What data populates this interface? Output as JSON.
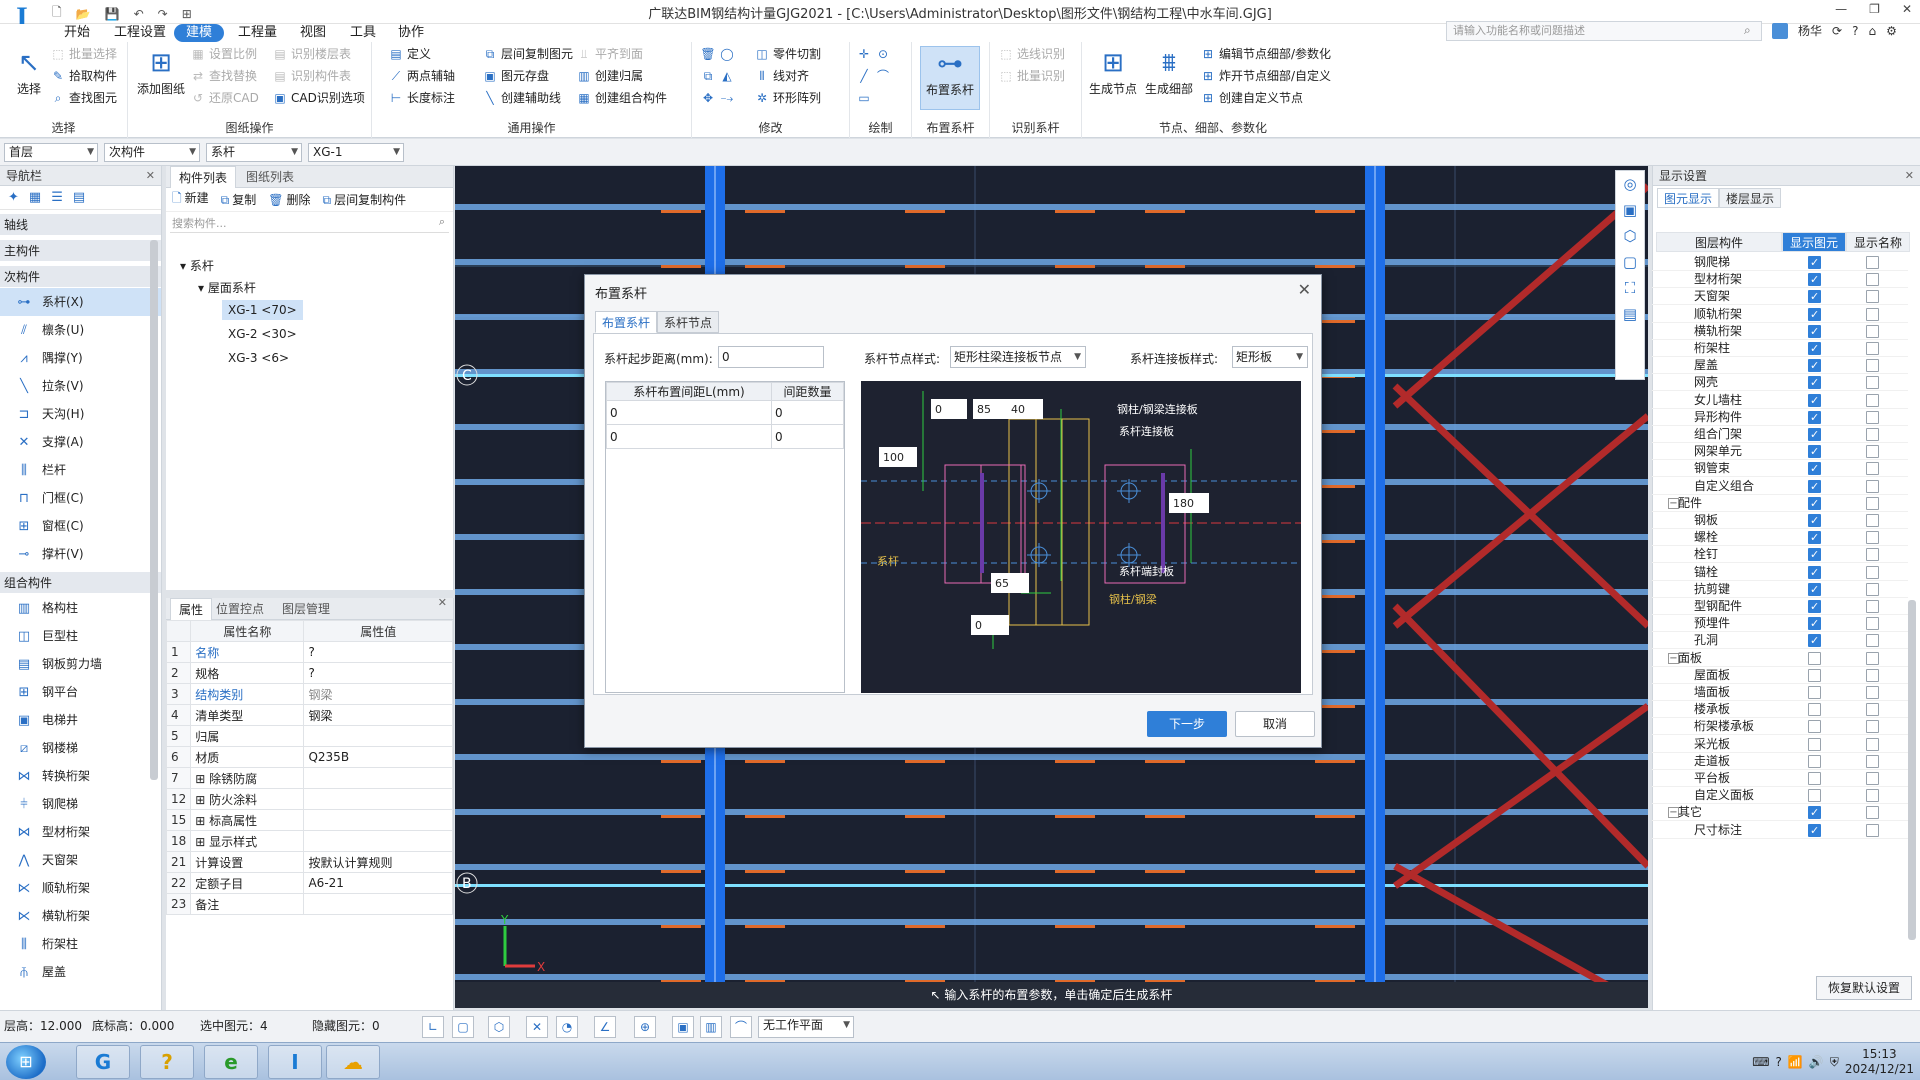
{
  "app": {
    "title": "广联达BIM钢结构计量GJG2021 - [C:\\Users\\Administrator\\Desktop\\图形文件\\钢结构工程\\中水车间.GJG]",
    "logo": "I"
  },
  "menu": {
    "items": [
      "开始",
      "工程设置",
      "建模",
      "工程量",
      "视图",
      "工具",
      "协作"
    ],
    "active": "建模"
  },
  "search": {
    "placeholder": "请输入功能名称或问题描述"
  },
  "user": {
    "name": "杨华"
  },
  "ribbon": {
    "select": {
      "big": "选择",
      "s1": "批量选择",
      "s2": "拾取构件",
      "s3": "查找图元",
      "title": "选择"
    },
    "drawing": {
      "big": "添加图纸",
      "s1": "设置比例",
      "s2": "查找替换",
      "s3": "还原CAD",
      "s4": "识别楼层表",
      "s5": "识别构件表",
      "s6": "CAD识别选项",
      "title": "图纸操作"
    },
    "general": {
      "s1": "定义",
      "s2": "两点辅轴",
      "s3": "长度标注",
      "s4": "层间复制图元",
      "s5": "图元存盘",
      "s6": "创建辅助线",
      "s7": "平齐到面",
      "s8": "创建归属",
      "s9": "创建组合构件",
      "title": "通用操作"
    },
    "modify": {
      "s1": "零件切割",
      "s2": "线对齐",
      "s3": "环形阵列",
      "title": "修改"
    },
    "draw": {
      "title": "绘制"
    },
    "arrange": {
      "big": "布置系杆",
      "title": "布置系杆"
    },
    "identify": {
      "s1": "选线识别",
      "s2": "批量识别",
      "title": "识别系杆"
    },
    "nodes": {
      "b1": "生成节点",
      "b2": "生成细部",
      "s1": "编辑节点细部/参数化",
      "s2": "炸开节点细部/自定义",
      "s3": "创建自定义节点",
      "title": "节点、细部、参数化"
    }
  },
  "selectors": {
    "floor": "首层",
    "category": "次构件",
    "type": "系杆",
    "component": "XG-1"
  },
  "nav": {
    "title": "导航栏",
    "cats": [
      "轴线",
      "主构件",
      "次构件",
      "组合构件"
    ],
    "secondary": [
      "系杆(X)",
      "檩条(U)",
      "隅撑(Y)",
      "拉条(V)",
      "天沟(H)",
      "支撑(A)",
      "栏杆",
      "门框(C)",
      "窗框(C)",
      "撑杆(V)"
    ],
    "combo": [
      "格构柱",
      "巨型柱",
      "钢板剪力墙",
      "钢平台",
      "电梯井",
      "钢楼梯",
      "转换桁架",
      "钢爬梯",
      "型材桁架",
      "天窗架",
      "顺轨桁架",
      "横轨桁架",
      "桁架柱",
      "屋盖"
    ]
  },
  "complist": {
    "tabs": [
      "构件列表",
      "图纸列表"
    ],
    "tools": [
      "新建",
      "复制",
      "删除",
      "层间复制构件"
    ],
    "search_placeholder": "搜索构件...",
    "tree": {
      "root": "系杆",
      "group": "屋面系杆",
      "items": [
        "XG-1 <70>",
        "XG-2 <30>",
        "XG-3 <6>"
      ]
    }
  },
  "props": {
    "tabs": [
      "属性",
      "位置控点",
      "图层管理"
    ],
    "head": [
      "属性名称",
      "属性值"
    ],
    "rows": [
      {
        "n": "1",
        "k": "名称",
        "v": "?"
      },
      {
        "n": "2",
        "k": "规格",
        "v": "?"
      },
      {
        "n": "3",
        "k": "结构类别",
        "v": "钢梁"
      },
      {
        "n": "4",
        "k": "清单类型",
        "v": "钢梁"
      },
      {
        "n": "5",
        "k": "归属",
        "v": ""
      },
      {
        "n": "6",
        "k": "材质",
        "v": "Q235B"
      },
      {
        "n": "7",
        "k": "除锈防腐",
        "v": ""
      },
      {
        "n": "12",
        "k": "防火涂料",
        "v": ""
      },
      {
        "n": "15",
        "k": "标高属性",
        "v": ""
      },
      {
        "n": "18",
        "k": "显示样式",
        "v": ""
      },
      {
        "n": "21",
        "k": "计算设置",
        "v": "按默认计算规则"
      },
      {
        "n": "22",
        "k": "定额子目",
        "v": "A6-21"
      },
      {
        "n": "23",
        "k": "备注",
        "v": ""
      }
    ]
  },
  "canvas": {
    "axis_labels": [
      "C",
      "B"
    ],
    "axis_x": "X",
    "axis_y": "Y",
    "status": "输入系杆的布置参数，单击确定后生成系杆"
  },
  "display": {
    "title": "显示设置",
    "tabs": [
      "图元显示",
      "楼层显示"
    ],
    "head": [
      "图层构件",
      "显示图元",
      "显示名称"
    ],
    "rows": [
      {
        "name": "钢爬梯",
        "show": true,
        "nm": false,
        "grp": false
      },
      {
        "name": "型材桁架",
        "show": true,
        "nm": false,
        "grp": false
      },
      {
        "name": "天窗架",
        "show": true,
        "nm": false,
        "grp": false
      },
      {
        "name": "顺轨桁架",
        "show": true,
        "nm": false,
        "grp": false
      },
      {
        "name": "横轨桁架",
        "show": true,
        "nm": false,
        "grp": false
      },
      {
        "name": "桁架柱",
        "show": true,
        "nm": false,
        "grp": false
      },
      {
        "name": "屋盖",
        "show": true,
        "nm": false,
        "grp": false
      },
      {
        "name": "网壳",
        "show": true,
        "nm": false,
        "grp": false
      },
      {
        "name": "女儿墙柱",
        "show": true,
        "nm": false,
        "grp": false
      },
      {
        "name": "异形构件",
        "show": true,
        "nm": false,
        "grp": false
      },
      {
        "name": "组合门架",
        "show": true,
        "nm": false,
        "grp": false
      },
      {
        "name": "网架单元",
        "show": true,
        "nm": false,
        "grp": false
      },
      {
        "name": "钢管束",
        "show": true,
        "nm": false,
        "grp": false
      },
      {
        "name": "自定义组合",
        "show": true,
        "nm": false,
        "grp": false
      },
      {
        "name": "配件",
        "show": true,
        "nm": false,
        "grp": true
      },
      {
        "name": "钢板",
        "show": true,
        "nm": false,
        "grp": false
      },
      {
        "name": "螺栓",
        "show": true,
        "nm": false,
        "grp": false
      },
      {
        "name": "栓钉",
        "show": true,
        "nm": false,
        "grp": false
      },
      {
        "name": "锚栓",
        "show": true,
        "nm": false,
        "grp": false
      },
      {
        "name": "抗剪键",
        "show": true,
        "nm": false,
        "grp": false
      },
      {
        "name": "型钢配件",
        "show": true,
        "nm": false,
        "grp": false
      },
      {
        "name": "预埋件",
        "show": true,
        "nm": false,
        "grp": false
      },
      {
        "name": "孔洞",
        "show": true,
        "nm": false,
        "grp": false
      },
      {
        "name": "面板",
        "show": false,
        "nm": false,
        "grp": true
      },
      {
        "name": "屋面板",
        "show": false,
        "nm": false,
        "grp": false
      },
      {
        "name": "墙面板",
        "show": false,
        "nm": false,
        "grp": false
      },
      {
        "name": "楼承板",
        "show": false,
        "nm": false,
        "grp": false
      },
      {
        "name": "桁架楼承板",
        "show": false,
        "nm": false,
        "grp": false
      },
      {
        "name": "采光板",
        "show": false,
        "nm": false,
        "grp": false
      },
      {
        "name": "走道板",
        "show": false,
        "nm": false,
        "grp": false
      },
      {
        "name": "平台板",
        "show": false,
        "nm": false,
        "grp": false
      },
      {
        "name": "自定义面板",
        "show": false,
        "nm": false,
        "grp": false
      },
      {
        "name": "其它",
        "show": true,
        "nm": false,
        "grp": true
      },
      {
        "name": "尺寸标注",
        "show": true,
        "nm": false,
        "grp": false
      }
    ],
    "restore": "恢复默认设置"
  },
  "status": {
    "floor_height": "层高：12.000",
    "bottom_elev": "底标高：0.000",
    "selected": "选中图元：4",
    "hidden": "隐藏图元：0",
    "workplane": "无工作平面"
  },
  "taskbar": {
    "time": "15:13",
    "date": "2024/12/21"
  },
  "dialog": {
    "title": "布置系杆",
    "tabs": [
      "布置系杆",
      "系杆节点"
    ],
    "start_label": "系杆起步距离(mm):",
    "start_value": "0",
    "node_style_label": "系杆节点样式:",
    "node_style_value": "矩形柱梁连接板节点",
    "plate_style_label": "系杆连接板样式:",
    "plate_style_value": "矩形板",
    "spacing_head": [
      "系杆布置间距L(mm)",
      "间距数量"
    ],
    "spacing_rows": [
      [
        "0",
        "0"
      ],
      [
        "0",
        "0"
      ]
    ],
    "diagram": {
      "v0": "0",
      "v85": "85",
      "v40": "40",
      "v100": "100",
      "v180": "180",
      "v65": "65",
      "vb0": "0",
      "t_plate": "钢柱/钢梁连接板",
      "t_conn": "系杆连接板",
      "t_bar": "系杆",
      "t_end": "系杆端封板",
      "t_col": "钢柱/钢梁"
    },
    "next": "下一步",
    "cancel": "取消"
  },
  "colors": {
    "accent": "#2f7fd8",
    "canvas_bg": "#1b2130",
    "beam": "#6fa8e6",
    "column": "#1e6ee8",
    "brace": "#b22a2a"
  }
}
